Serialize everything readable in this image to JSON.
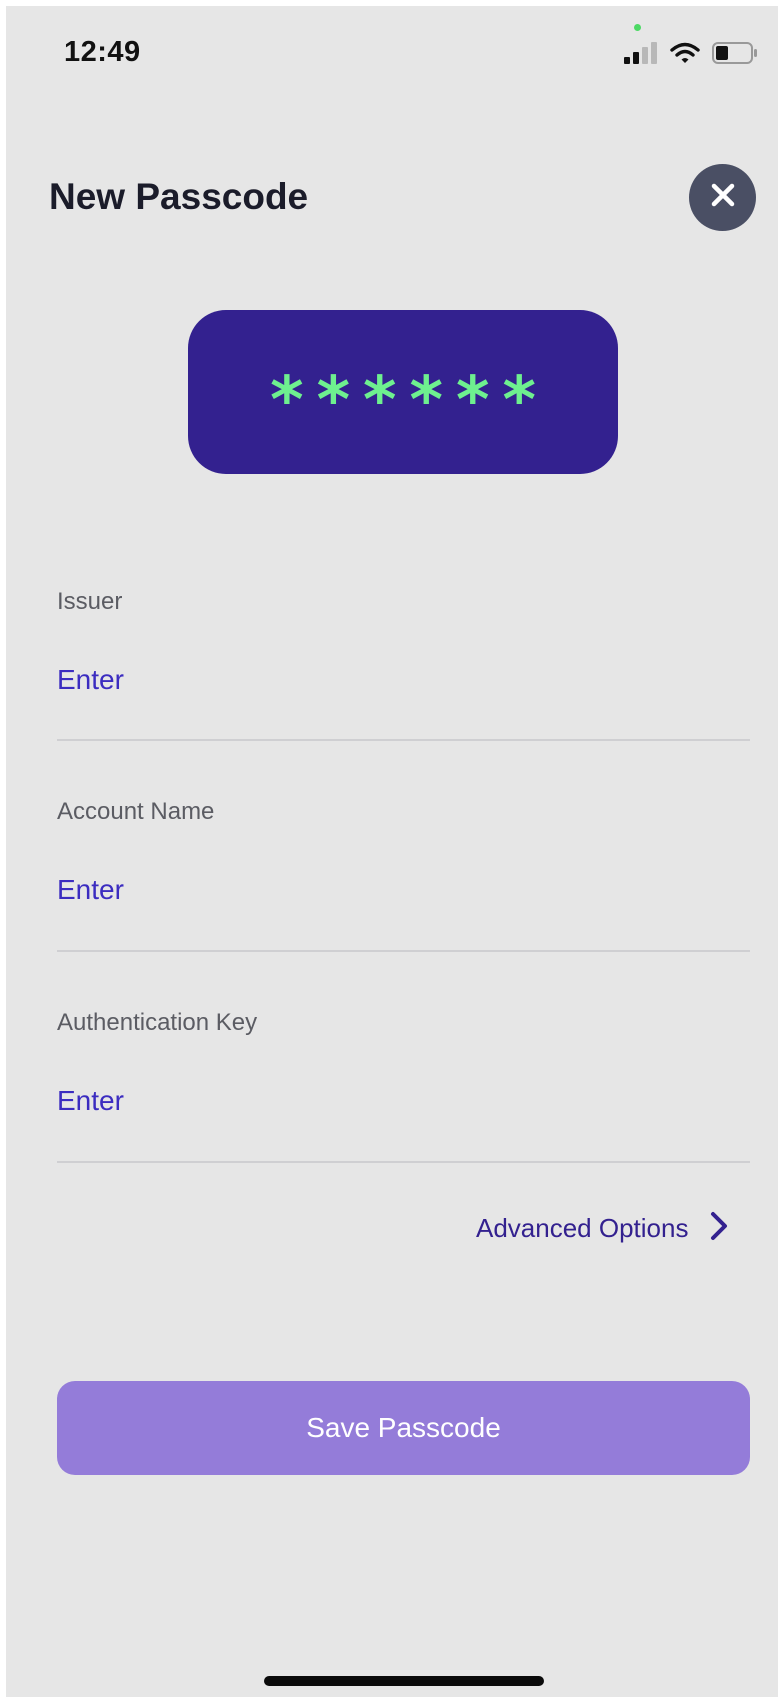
{
  "status_bar": {
    "time": "12:49",
    "signal_icon": "cellular-signal-icon",
    "wifi_icon": "wifi-icon",
    "battery_icon": "battery-icon"
  },
  "header": {
    "title": "New Passcode",
    "close_icon": "close-icon"
  },
  "passcode_display": {
    "code": "******"
  },
  "form": {
    "issuer": {
      "label": "Issuer",
      "placeholder": "Enter",
      "value": ""
    },
    "account_name": {
      "label": "Account Name",
      "placeholder": "Enter",
      "value": ""
    },
    "authentication_key": {
      "label": "Authentication Key",
      "placeholder": "Enter",
      "value": ""
    }
  },
  "advanced_options": {
    "label": "Advanced Options",
    "icon": "chevron-right-icon"
  },
  "save_button": {
    "label": "Save Passcode"
  },
  "colors": {
    "background": "#e6e6e6",
    "accent": "#33218f",
    "code_text": "#6ef08f",
    "input_text": "#3b2cc0",
    "save_button": "#947cd9",
    "close_button": "#4a4f64"
  }
}
